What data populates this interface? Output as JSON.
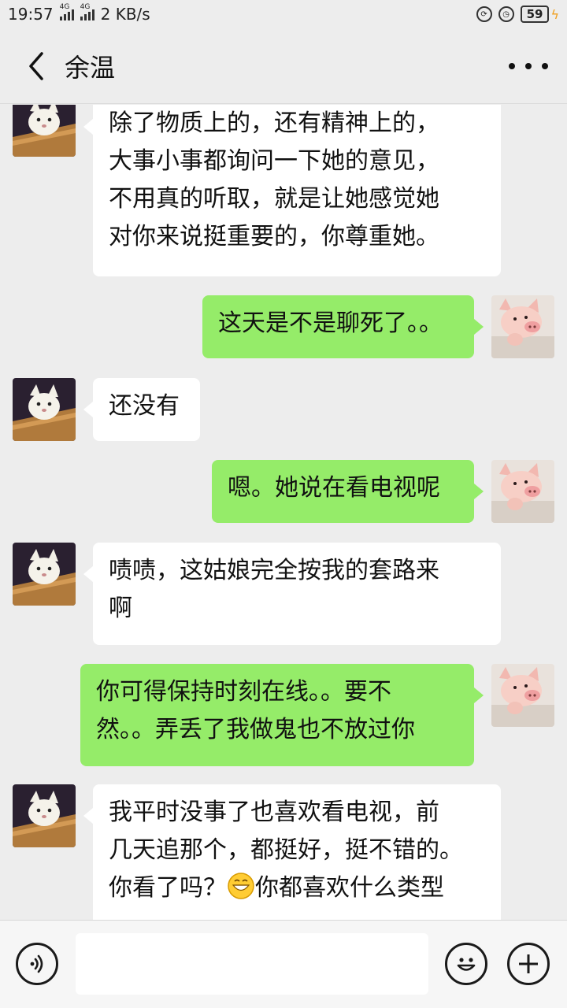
{
  "status_bar": {
    "time": "19:57",
    "net1": "4G",
    "net2": "4G",
    "speed": "2 KB/s",
    "battery": "59"
  },
  "header": {
    "title": "余温"
  },
  "messages": [
    {
      "side": "in",
      "text": "除了物质上的，还有精神上的，\n大事小事都询问一下她的意见，\n不用真的听取，就是让她感觉她\n对你来说挺重要的，你尊重她。"
    },
    {
      "side": "out",
      "text": "这天是不是聊死了。。"
    },
    {
      "side": "in",
      "text": "还没有"
    },
    {
      "side": "out",
      "text": "嗯。她说在看电视呢"
    },
    {
      "side": "in",
      "text": "啧啧，这姑娘完全按我的套路来\n啊"
    },
    {
      "side": "out",
      "text": "你可得保持时刻在线。。要不\n然。。弄丢了我做鬼也不放过你"
    },
    {
      "side": "in",
      "text_a": "我平时没事了也喜欢看电视，前\n几天追那个，都挺好，挺不错的。\n你看了吗？",
      "text_b": "你都喜欢什么类型"
    }
  ],
  "input_bar": {
    "placeholder": ""
  },
  "colors": {
    "outgoing_bubble": "#95ec69",
    "incoming_bubble": "#ffffff",
    "background": "#ededed"
  },
  "icons": {
    "back": "chevron-left-icon",
    "more": "more-dots-icon",
    "voice": "voice-icon",
    "emoji": "emoji-icon",
    "plus": "plus-icon"
  }
}
